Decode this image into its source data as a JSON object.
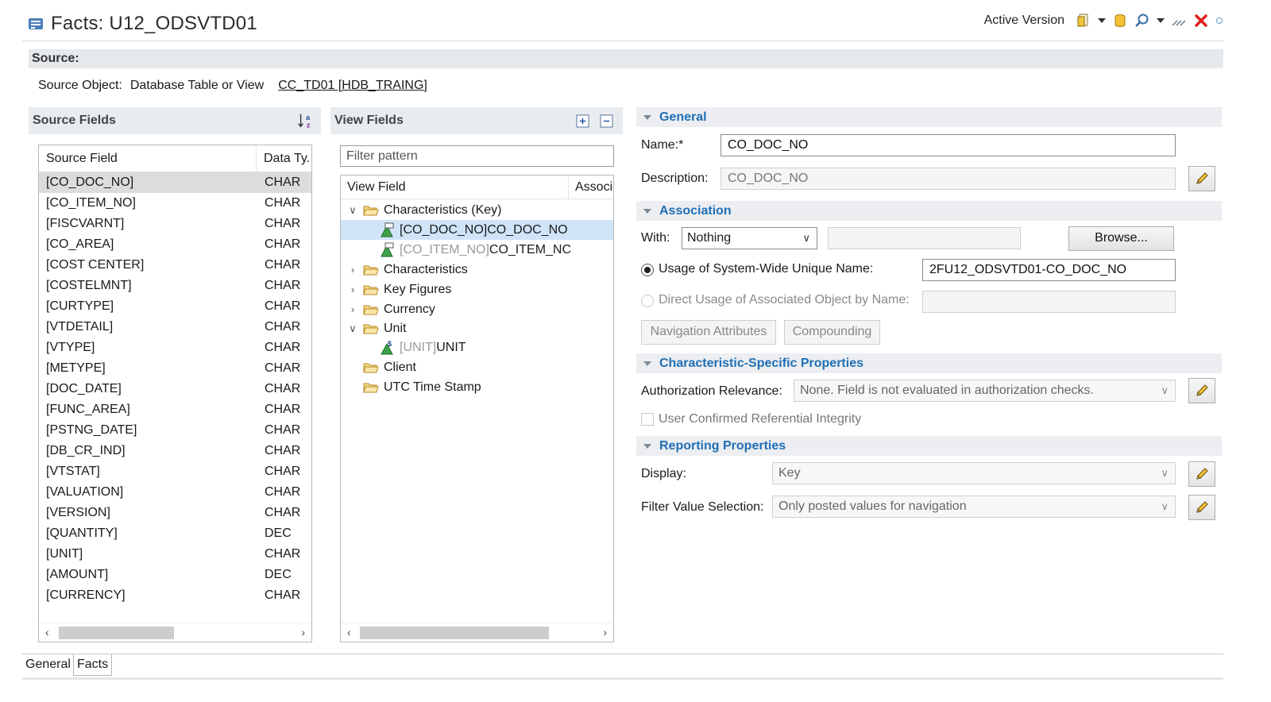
{
  "window": {
    "title": "Facts: U12_ODSVTD01",
    "version_label": "Active Version"
  },
  "source": {
    "section_label": "Source:",
    "object_label": "Source Object:",
    "object_type": "Database Table or View",
    "object_link": "CC_TD01 [HDB_TRAING]"
  },
  "source_fields": {
    "header": "Source Fields",
    "col_field": "Source Field",
    "col_type": "Data Ty.",
    "rows": [
      {
        "field": "[CO_DOC_NO]",
        "type": "CHAR"
      },
      {
        "field": "[CO_ITEM_NO]",
        "type": "CHAR"
      },
      {
        "field": "[FISCVARNT]",
        "type": "CHAR"
      },
      {
        "field": "[CO_AREA]",
        "type": "CHAR"
      },
      {
        "field": "[COST CENTER]",
        "type": "CHAR"
      },
      {
        "field": "[COSTELMNT]",
        "type": "CHAR"
      },
      {
        "field": "[CURTYPE]",
        "type": "CHAR"
      },
      {
        "field": "[VTDETAIL]",
        "type": "CHAR"
      },
      {
        "field": "[VTYPE]",
        "type": "CHAR"
      },
      {
        "field": "[METYPE]",
        "type": "CHAR"
      },
      {
        "field": "[DOC_DATE]",
        "type": "CHAR"
      },
      {
        "field": "[FUNC_AREA]",
        "type": "CHAR"
      },
      {
        "field": "[PSTNG_DATE]",
        "type": "CHAR"
      },
      {
        "field": "[DB_CR_IND]",
        "type": "CHAR"
      },
      {
        "field": "[VTSTAT]",
        "type": "CHAR"
      },
      {
        "field": "[VALUATION]",
        "type": "CHAR"
      },
      {
        "field": "[VERSION]",
        "type": "CHAR"
      },
      {
        "field": "[QUANTITY]",
        "type": "DEC"
      },
      {
        "field": "[UNIT]",
        "type": "CHAR"
      },
      {
        "field": "[AMOUNT]",
        "type": "DEC"
      },
      {
        "field": "[CURRENCY]",
        "type": "CHAR"
      }
    ]
  },
  "view_fields": {
    "header": "View Fields",
    "filter_placeholder": "Filter pattern",
    "col_field": "View Field",
    "col_assoc": "Associ",
    "tree": {
      "char_key": "Characteristics (Key)",
      "item1_src": "[CO_DOC_NO]",
      "item1_name": " CO_DOC_NO",
      "item2_src": "[CO_ITEM_NO]",
      "item2_name": " CO_ITEM_NC",
      "characteristics": "Characteristics",
      "key_figures": "Key Figures",
      "currency": "Currency",
      "unit": "Unit",
      "unit_src": "[UNIT]",
      "unit_name": " UNIT",
      "client": "Client",
      "utc": "UTC Time Stamp"
    }
  },
  "general": {
    "title": "General",
    "name_label": "Name:*",
    "name_value": "CO_DOC_NO",
    "desc_label": "Description:",
    "desc_value": "CO_DOC_NO"
  },
  "association": {
    "title": "Association",
    "with_label": "With:",
    "with_value": "Nothing",
    "browse": "Browse...",
    "usage_label": "Usage of System-Wide Unique Name:",
    "usage_value": "2FU12_ODSVTD01-CO_DOC_NO",
    "direct_label": "Direct Usage of Associated Object by Name:",
    "nav_attr": "Navigation Attributes",
    "compounding": "Compounding"
  },
  "char_props": {
    "title": "Characteristic-Specific Properties",
    "auth_label": "Authorization Relevance:",
    "auth_value": "None. Field is not evaluated in authorization checks.",
    "ref_integrity": "User Confirmed Referential Integrity"
  },
  "reporting": {
    "title": "Reporting Properties",
    "display_label": "Display:",
    "display_value": "Key",
    "filter_label": "Filter Value Selection:",
    "filter_value": "Only posted values for navigation"
  },
  "tabs": [
    "General",
    "Facts"
  ]
}
